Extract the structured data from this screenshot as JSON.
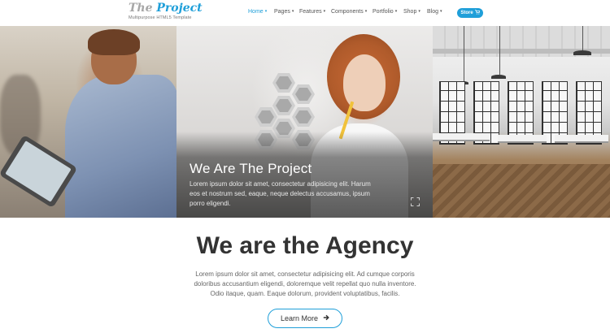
{
  "logo": {
    "title_the": "The",
    "title_project": "Project",
    "tagline": "Multipurpose HTML5 Template"
  },
  "nav": {
    "items": [
      {
        "label": "Home",
        "active": true
      },
      {
        "label": "Pages",
        "active": false
      },
      {
        "label": "Features",
        "active": false
      },
      {
        "label": "Components",
        "active": false
      },
      {
        "label": "Portfolio",
        "active": false
      },
      {
        "label": "Shop",
        "active": false
      },
      {
        "label": "Blog",
        "active": false
      }
    ],
    "store_label": "Store",
    "store_icon": "cart-icon"
  },
  "hero": {
    "caption_title": "We Are The Project",
    "caption_text": "Lorem ipsum dolor sit amet, consectetur adipisicing elit. Harum eos et nostrum sed, eaque, neque delectus accusamus, ipsum porro eligendi.",
    "expand_icon": "expand-icon"
  },
  "main": {
    "title": "We are the Agency",
    "text": "Lorem ipsum dolor sit amet, consectetur adipisicing elit. Ad cumque corporis doloribus accusantium eligendi, doloremque velit repellat quo nulla inventore. Odio itaque, quam. Eaque dolorum, provident voluptatibus, facilis.",
    "button_label": "Learn More",
    "button_icon": "arrow-right-icon"
  },
  "colors": {
    "accent": "#1f9fd9",
    "text_dark": "#333333",
    "text_muted": "#666666"
  }
}
